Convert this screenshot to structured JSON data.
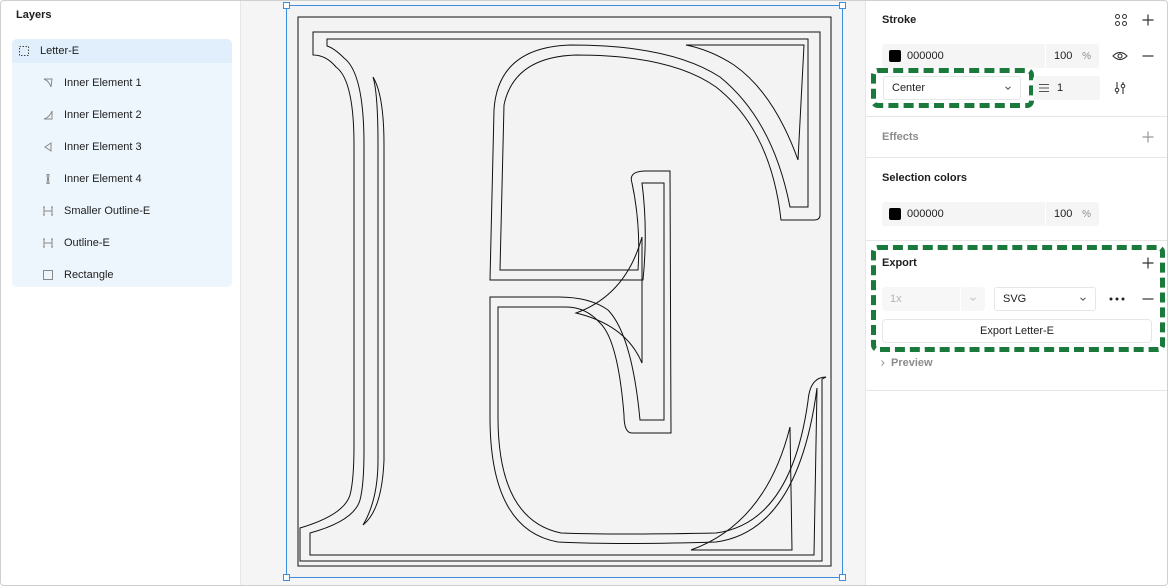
{
  "layers_panel": {
    "title": "Layers",
    "items": [
      {
        "label": "Letter-E",
        "icon": "frame-dashed-icon",
        "selected": true
      },
      {
        "label": "Inner Element 1",
        "icon": "vector-path-icon"
      },
      {
        "label": "Inner Element 2",
        "icon": "vector-path-icon"
      },
      {
        "label": "Inner Element 3",
        "icon": "vector-path-icon"
      },
      {
        "label": "Inner Element 4",
        "icon": "vector-path-icon"
      },
      {
        "label": "Smaller Outline-E",
        "icon": "vector-path-icon"
      },
      {
        "label": "Outline-E",
        "icon": "vector-path-icon"
      },
      {
        "label": "Rectangle",
        "icon": "rectangle-icon"
      }
    ]
  },
  "stroke": {
    "title": "Stroke",
    "color_hex": "000000",
    "opacity": "100",
    "percent_sign": "%",
    "position": "Center",
    "weight": "1",
    "color": "#000000"
  },
  "effects": {
    "title": "Effects"
  },
  "selection_colors": {
    "title": "Selection colors",
    "color_hex": "000000",
    "opacity": "100",
    "percent_sign": "%",
    "color": "#000000"
  },
  "export": {
    "title": "Export",
    "scale": "1x",
    "format": "SVG",
    "button_label": "Export Letter-E",
    "preview_label": "Preview"
  },
  "colors": {
    "selection_blue": "#3b8fe0",
    "highlight_green": "#1a7a3c",
    "layer_selected_bg": "#e0effb"
  }
}
